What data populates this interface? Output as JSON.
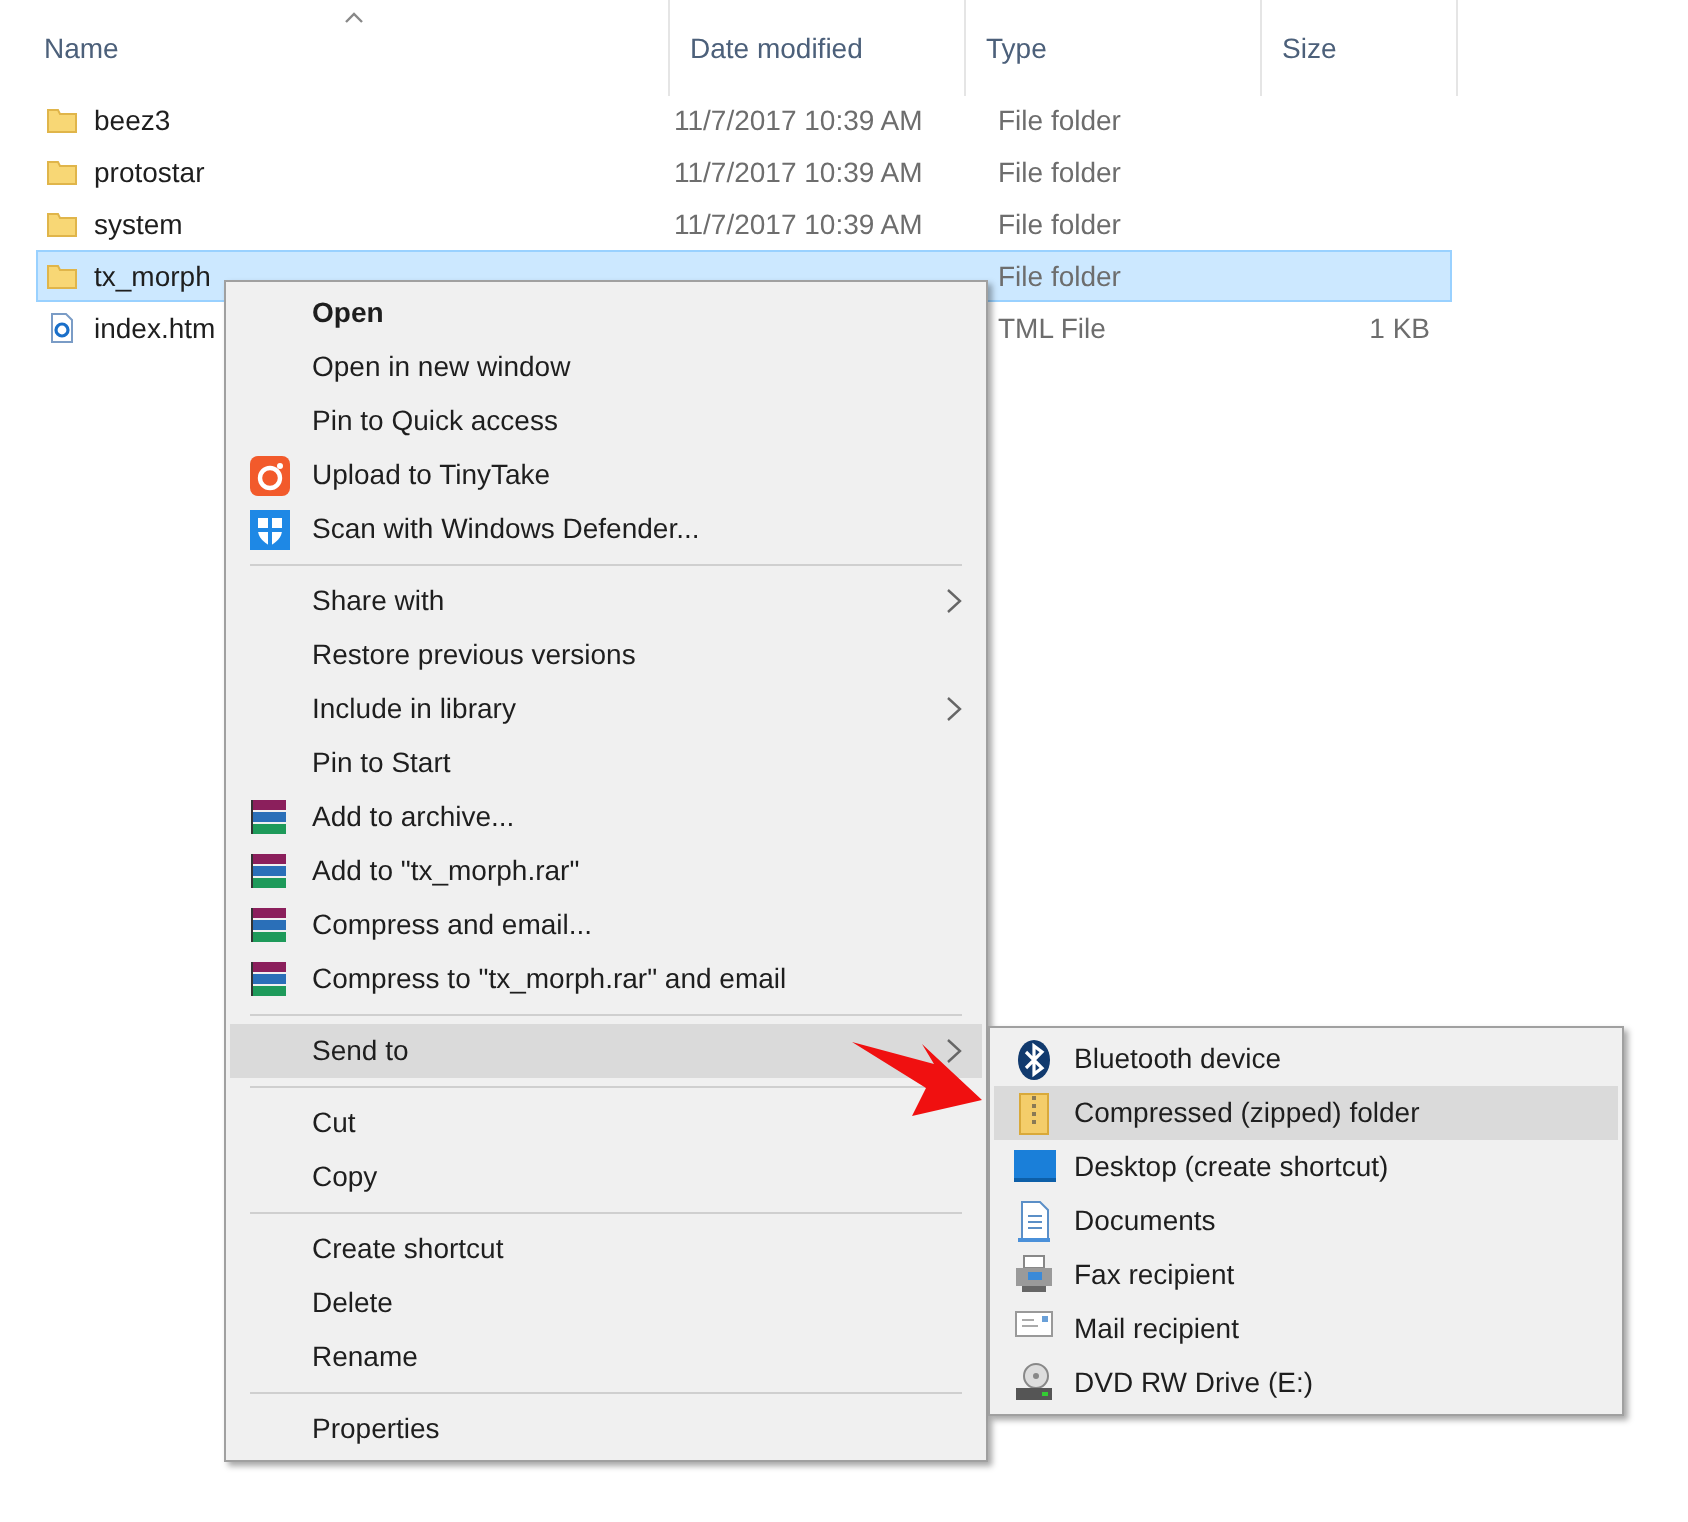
{
  "columns": [
    "Name",
    "Date modified",
    "Type",
    "Size"
  ],
  "files": [
    {
      "kind": "folder",
      "name": "beez3",
      "date": "11/7/2017 10:39 AM",
      "type": "File folder",
      "selected": false
    },
    {
      "kind": "folder",
      "name": "protostar",
      "date": "11/7/2017 10:39 AM",
      "type": "File folder",
      "selected": false
    },
    {
      "kind": "folder",
      "name": "system",
      "date": "11/7/2017 10:39 AM",
      "type": "File folder",
      "selected": false
    },
    {
      "kind": "folder",
      "name": "tx_morph",
      "type": "File folder",
      "selected": true
    },
    {
      "kind": "webpage",
      "name": "index.htm",
      "type": "TML File",
      "size": "1 KB",
      "selected": false
    }
  ],
  "context_menu": [
    {
      "kind": "plain",
      "label": "Open",
      "default": true,
      "submenu": false,
      "selected": false
    },
    {
      "kind": "plain",
      "label": "Open in new window",
      "default": false,
      "submenu": false,
      "selected": false
    },
    {
      "kind": "plain",
      "label": "Pin to Quick access",
      "default": false,
      "submenu": false,
      "selected": false
    },
    {
      "kind": "tinytake",
      "label": "Upload to TinyTake",
      "default": false,
      "submenu": false,
      "selected": false
    },
    {
      "kind": "shield",
      "label": "Scan with Windows Defender...",
      "default": false,
      "submenu": false,
      "selected": false
    },
    {
      "kind": "separator"
    },
    {
      "kind": "plain",
      "label": "Share with",
      "default": false,
      "submenu": true,
      "selected": false
    },
    {
      "kind": "plain",
      "label": "Restore previous versions",
      "default": false,
      "submenu": false,
      "selected": false
    },
    {
      "kind": "plain",
      "label": "Include in library",
      "default": false,
      "submenu": true,
      "selected": false
    },
    {
      "kind": "plain",
      "label": "Pin to Start",
      "default": false,
      "submenu": false,
      "selected": false
    },
    {
      "kind": "archive",
      "label": "Add to archive...",
      "default": false,
      "submenu": false,
      "selected": false
    },
    {
      "kind": "archive",
      "label": "Add to \"tx_morph.rar\"",
      "default": false,
      "submenu": false,
      "selected": false
    },
    {
      "kind": "archive",
      "label": "Compress and email...",
      "default": false,
      "submenu": false,
      "selected": false
    },
    {
      "kind": "archive",
      "label": "Compress to \"tx_morph.rar\" and email",
      "default": false,
      "submenu": false,
      "selected": false
    },
    {
      "kind": "separator"
    },
    {
      "kind": "plain",
      "label": "Send to",
      "default": false,
      "submenu": true,
      "selected": true
    },
    {
      "kind": "separator"
    },
    {
      "kind": "plain",
      "label": "Cut",
      "default": false,
      "submenu": false,
      "selected": false
    },
    {
      "kind": "plain",
      "label": "Copy",
      "default": false,
      "submenu": false,
      "selected": false
    },
    {
      "kind": "separator"
    },
    {
      "kind": "plain",
      "label": "Create shortcut",
      "default": false,
      "submenu": false,
      "selected": false
    },
    {
      "kind": "plain",
      "label": "Delete",
      "default": false,
      "submenu": false,
      "selected": false
    },
    {
      "kind": "plain",
      "label": "Rename",
      "default": false,
      "submenu": false,
      "selected": false
    },
    {
      "kind": "separator"
    },
    {
      "kind": "plain",
      "label": "Properties",
      "default": false,
      "submenu": false,
      "selected": false
    }
  ],
  "send_to_menu": [
    {
      "kind": "bluetooth",
      "label": "Bluetooth device",
      "selected": false
    },
    {
      "kind": "zip",
      "label": "Compressed (zipped) folder",
      "selected": true
    },
    {
      "kind": "desktop",
      "label": "Desktop (create shortcut)",
      "selected": false
    },
    {
      "kind": "documents",
      "label": "Documents",
      "selected": false
    },
    {
      "kind": "fax",
      "label": "Fax recipient",
      "selected": false
    },
    {
      "kind": "mail",
      "label": "Mail recipient",
      "selected": false
    },
    {
      "kind": "dvd",
      "label": "DVD RW Drive (E:)",
      "selected": false
    }
  ]
}
